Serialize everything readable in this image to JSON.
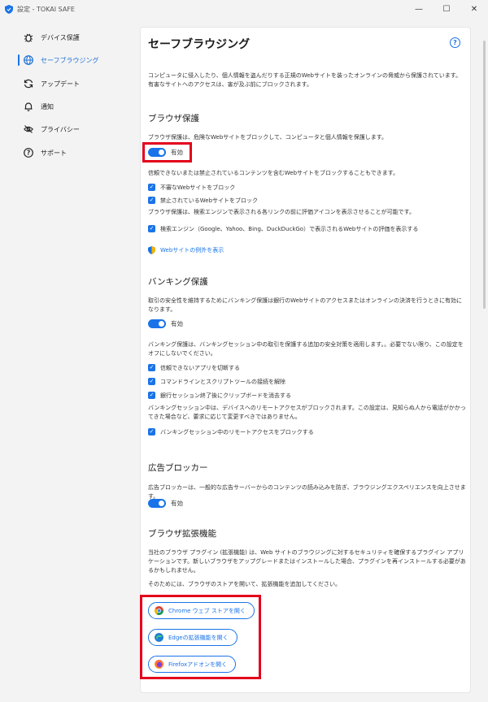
{
  "window": {
    "title": "設定 - TOKAI SAFE",
    "minimize": "—",
    "maximize": "☐",
    "close": "✕"
  },
  "sidebar": {
    "items": [
      {
        "label": "デバイス保護",
        "icon": "bug-icon"
      },
      {
        "label": "セーフブラウジング",
        "icon": "globe-icon",
        "active": true
      },
      {
        "label": "アップデート",
        "icon": "refresh-icon"
      },
      {
        "label": "通知",
        "icon": "bell-icon"
      },
      {
        "label": "プライバシー",
        "icon": "eye-off-icon"
      },
      {
        "label": "サポート",
        "icon": "help-circle-icon"
      }
    ]
  },
  "main": {
    "title": "セーフブラウジング",
    "help_icon": "?",
    "intro": "コンピュータに侵入したり、個人情報を盗んだりする正規のWebサイトを装ったオンラインの脅威から保護されています。有害なサイトへのアクセスは、害が及ぶ前にブロックされます。",
    "browser_protection": {
      "heading": "ブラウザ保護",
      "desc": "ブラウザ保護は、危険なWebサイトをブロックして、コンピュータと個人情報を保護します。",
      "toggle_label": "有効",
      "desc2": "信頼できないまたは禁止されているコンテンツを含むWebサイトをブロックすることもできます。",
      "check1": "不審なWebサイトをブロック",
      "check2": "禁止されているWebサイトをブロック",
      "desc3": "ブラウザ保護は、検索エンジンで表示される各リンクの前に評価アイコンを表示させることが可能です。",
      "check3": "検索エンジン（Google、Yahoo、Bing、DuckDuckGo）で表示されるWebサイトの評価を表示する",
      "exceptions_link": "Webサイトの例外を表示"
    },
    "banking_protection": {
      "heading": "バンキング保護",
      "desc": "取引の安全性を維持するためにバンキング保護は銀行のWebサイトのアクセスまたはオンラインの決済を行うときに有効になります。",
      "toggle_label": "有効",
      "desc2": "バンキング保護は、バンキングセッション中の取引を保護する追加の安全対策を適用します。。必要でない限り、この設定をオフにしないでください。",
      "check1": "信頼できないアプリを切断する",
      "check2": "コマンドラインとスクリプトツールの接続を解除",
      "check3": "銀行セッション終了後にクリップボードを消去する",
      "desc3": "バンキングセッション中は、デバイスへのリモートアクセスがブロックされます。この設定は、見知らぬ人から電話がかかってきた場合など、要求に応じて変更すべきではありません。",
      "check4": "バンキングセッション中のリモートアクセスをブロックする"
    },
    "ad_blocker": {
      "heading": "広告ブロッカー",
      "desc": "広告ブロッカーは、一般的な広告サーバーからのコンテンツの読み込みを防ぎ、ブラウジングエクスペリエンスを向上させます。",
      "toggle_label": "有効"
    },
    "extensions": {
      "heading": "ブラウザ拡張機能",
      "desc": "当社のブラウザ プラグイン (拡張機能) は、Web サイトのブラウジングに対するセキュリティを確保するプラグイン アプリケーションです。新しいブラウザをアップグレードまたはインストールした場合、プラグインを再インストールする必要があるかもしれません。",
      "desc2": "そのためには、ブラウザのストアを開いて、拡張機能を追加してください。",
      "chrome_button": "Chrome ウェブ ストアを開く",
      "edge_button": "Edgeの拡張機能を開く",
      "firefox_button": "Firefoxアドオンを開く"
    }
  },
  "colors": {
    "accent": "#1a73e8",
    "highlight": "#e3001b"
  }
}
